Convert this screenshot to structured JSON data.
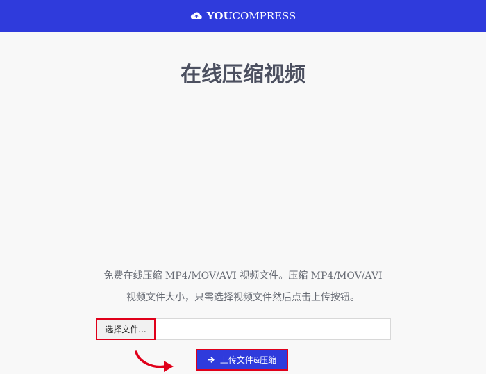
{
  "header": {
    "brand_strong": "YOU",
    "brand_light": "COMPRESS",
    "brand_color": "#2f3bdc",
    "logo_icon": "cloud-upload-icon"
  },
  "main": {
    "title": "在线压缩视频",
    "description_line1": "免费在线压缩 MP4/MOV/AVI 视频文件。压缩 MP4/MOV/AVI",
    "description_line2": "视频文件大小，只需选择视频文件然后点击上传按钮。"
  },
  "form": {
    "choose_file_label": "选择文件...",
    "upload_label": "上传文件&压缩",
    "upload_icon": "arrow-right-icon",
    "highlight_color": "#e0001a"
  }
}
